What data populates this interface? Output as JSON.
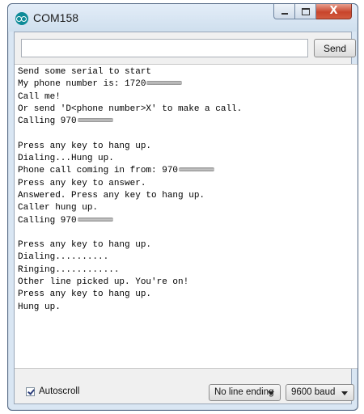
{
  "window": {
    "title": "COM158",
    "close_glyph": "X"
  },
  "send": {
    "input_value": "",
    "button_label": "Send"
  },
  "serial_output": [
    {
      "text": "Send some serial to start",
      "redacted": false
    },
    {
      "text": "My phone number is: 1720",
      "redacted": true
    },
    {
      "text": "Call me!",
      "redacted": false
    },
    {
      "text": "Or send 'D<phone number>X' to make a call.",
      "redacted": false
    },
    {
      "text": "Calling 970",
      "redacted": true
    },
    {
      "text": "",
      "redacted": false
    },
    {
      "text": "Press any key to hang up.",
      "redacted": false
    },
    {
      "text": "Dialing...Hung up.",
      "redacted": false
    },
    {
      "text": "Phone call coming in from: 970",
      "redacted": true
    },
    {
      "text": "Press any key to answer.",
      "redacted": false
    },
    {
      "text": "Answered. Press any key to hang up.",
      "redacted": false
    },
    {
      "text": "Caller hung up.",
      "redacted": false
    },
    {
      "text": "Calling 970",
      "redacted": true
    },
    {
      "text": "",
      "redacted": false
    },
    {
      "text": "Press any key to hang up.",
      "redacted": false
    },
    {
      "text": "Dialing..........",
      "redacted": false
    },
    {
      "text": "Ringing............",
      "redacted": false
    },
    {
      "text": "Other line picked up. You're on!",
      "redacted": false
    },
    {
      "text": "Press any key to hang up.",
      "redacted": false
    },
    {
      "text": "Hung up.",
      "redacted": false
    }
  ],
  "bottom": {
    "autoscroll_label": "Autoscroll",
    "autoscroll_checked": true,
    "line_ending": "No line ending",
    "baud": "9600 baud"
  },
  "icons": [
    "arduino-icon",
    "minimize-icon",
    "maximize-icon",
    "close-icon",
    "checkbox-checked-icon",
    "dropdown-arrow-icon"
  ],
  "colors": {
    "titlebar": "#d9e6f3",
    "close_button": "#c8452c",
    "app_icon": "#0e8b98"
  }
}
